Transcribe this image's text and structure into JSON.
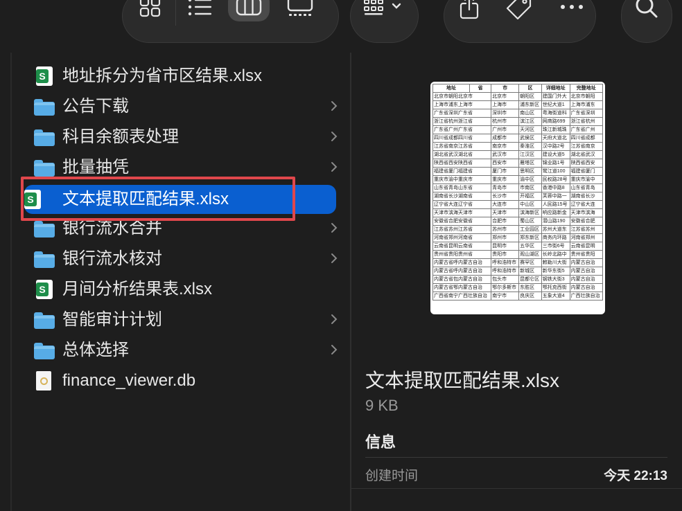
{
  "toolbar": {
    "buttons": [
      "grid-view",
      "list-view",
      "column-view",
      "gallery-view",
      "group-by",
      "share",
      "tags",
      "more",
      "search"
    ]
  },
  "files": [
    {
      "name": "地址拆分为省市区结果.xlsx",
      "kind": "xlsx",
      "folder": false
    },
    {
      "name": "公告下载",
      "kind": "folder",
      "folder": true
    },
    {
      "name": "科目余额表处理",
      "kind": "folder",
      "folder": true
    },
    {
      "name": "批量抽凭",
      "kind": "folder",
      "folder": true
    },
    {
      "name": "文本提取匹配结果.xlsx",
      "kind": "xlsx",
      "folder": false,
      "selected": true
    },
    {
      "name": "银行流水合并",
      "kind": "folder",
      "folder": true
    },
    {
      "name": "银行流水核对",
      "kind": "folder",
      "folder": true
    },
    {
      "name": "月间分析结果表.xlsx",
      "kind": "xlsx",
      "folder": false
    },
    {
      "name": "智能审计计划",
      "kind": "folder",
      "folder": true
    },
    {
      "name": "总体选择",
      "kind": "folder",
      "folder": true
    },
    {
      "name": "finance_viewer.db",
      "kind": "db",
      "folder": false
    }
  ],
  "preview": {
    "name": "文本提取匹配结果.xlsx",
    "size": "9 KB",
    "info_heading": "信息",
    "created_label": "创建时间",
    "created_value": "今天 22:13",
    "sheet_header": [
      "地址",
      "省",
      "市",
      "区",
      "详细地址",
      "完整地址"
    ],
    "sheet_rows": [
      [
        "北京市朝阳北京市",
        "北京市",
        "朝阳区",
        "建国门外大",
        "北京市朝阳"
      ],
      [
        "上海市浦东上海市",
        "上海市",
        "浦东新区",
        "世纪大道1",
        "上海市浦东"
      ],
      [
        "广东省深圳广东省",
        "深圳市",
        "南山区",
        "粤海街道科",
        "广东省深圳"
      ],
      [
        "浙江省杭州浙江省",
        "杭州市",
        "滨江区",
        "网商路699",
        "浙江省杭州"
      ],
      [
        "广东省广州广东省",
        "广州市",
        "天河区",
        "珠江新城珠",
        "广东省广州"
      ],
      [
        "四川省成都四川省",
        "成都市",
        "武侯区",
        "天府大道北",
        "四川省成都"
      ],
      [
        "江苏省南京江苏省",
        "南京市",
        "秦淮区",
        "汉中路2号",
        "江苏省南京"
      ],
      [
        "湖北省武汉湖北省",
        "武汉市",
        "江汉区",
        "建设大道5",
        "湖北省武汉"
      ],
      [
        "陕西省西安陕西省",
        "西安市",
        "雁塔区",
        "锦业路1号",
        "陕西省西安"
      ],
      [
        "福建省厦门福建省",
        "厦门市",
        "思明区",
        "鹭江道100",
        "福建省厦门"
      ],
      [
        "重庆市渝中重庆市",
        "重庆市",
        "渝中区",
        "民权路28号",
        "重庆市渝中"
      ],
      [
        "山东省青岛山东省",
        "青岛市",
        "市南区",
        "香港中路8",
        "山东省青岛"
      ],
      [
        "湖南省长沙湖南省",
        "长沙市",
        "开福区",
        "芙蓉中路一",
        "湖南省长沙"
      ],
      [
        "辽宁省大连辽宁省",
        "大连市",
        "中山区",
        "人民路15号",
        "辽宁省大连"
      ],
      [
        "天津市滨海天津市",
        "天津市",
        "滨海新区",
        "响应路新金",
        "天津市滨海"
      ],
      [
        "安徽省合肥安徽省",
        "合肥市",
        "蜀山区",
        "潜山路190",
        "安徽省合肥"
      ],
      [
        "江苏省苏州江苏省",
        "苏州市",
        "工业园区",
        "苏州大道东",
        "江苏省苏州"
      ],
      [
        "河南省郑州河南省",
        "郑州市",
        "郑东新区",
        "商务内环路",
        "河南省郑州"
      ],
      [
        "云南省昆明云南省",
        "昆明市",
        "五华区",
        "三市街6号",
        "云南省昆明"
      ],
      [
        "贵州省贵阳贵州省",
        "贵阳市",
        "观山湖区",
        "长岭北路中",
        "贵州省贵阳"
      ],
      [
        "内蒙古省呼内蒙古自治",
        "呼和浩特市",
        "赛罕区",
        "敕勒川大街",
        "内蒙古自治"
      ],
      [
        "内蒙古省呼内蒙古自治",
        "呼和浩特市",
        "新城区",
        "新华东街5",
        "内蒙古自治"
      ],
      [
        "内蒙古省包内蒙古自治",
        "包头市",
        "昆都仑区",
        "钢铁大街3",
        "内蒙古自治"
      ],
      [
        "内蒙古省鄂内蒙古自治",
        "鄂尔多斯市",
        "东胜区",
        "鄂托克西街",
        "内蒙古自治"
      ],
      [
        "广西省南宁广西壮族自治",
        "南宁市",
        "良庆区",
        "五象大道4",
        "广西壮族自治"
      ]
    ]
  },
  "colors": {
    "selection": "#0a5fd0",
    "highlight_box": "#e0474c",
    "folder": "#57ace6",
    "xlsx": "#1e8e4a"
  }
}
